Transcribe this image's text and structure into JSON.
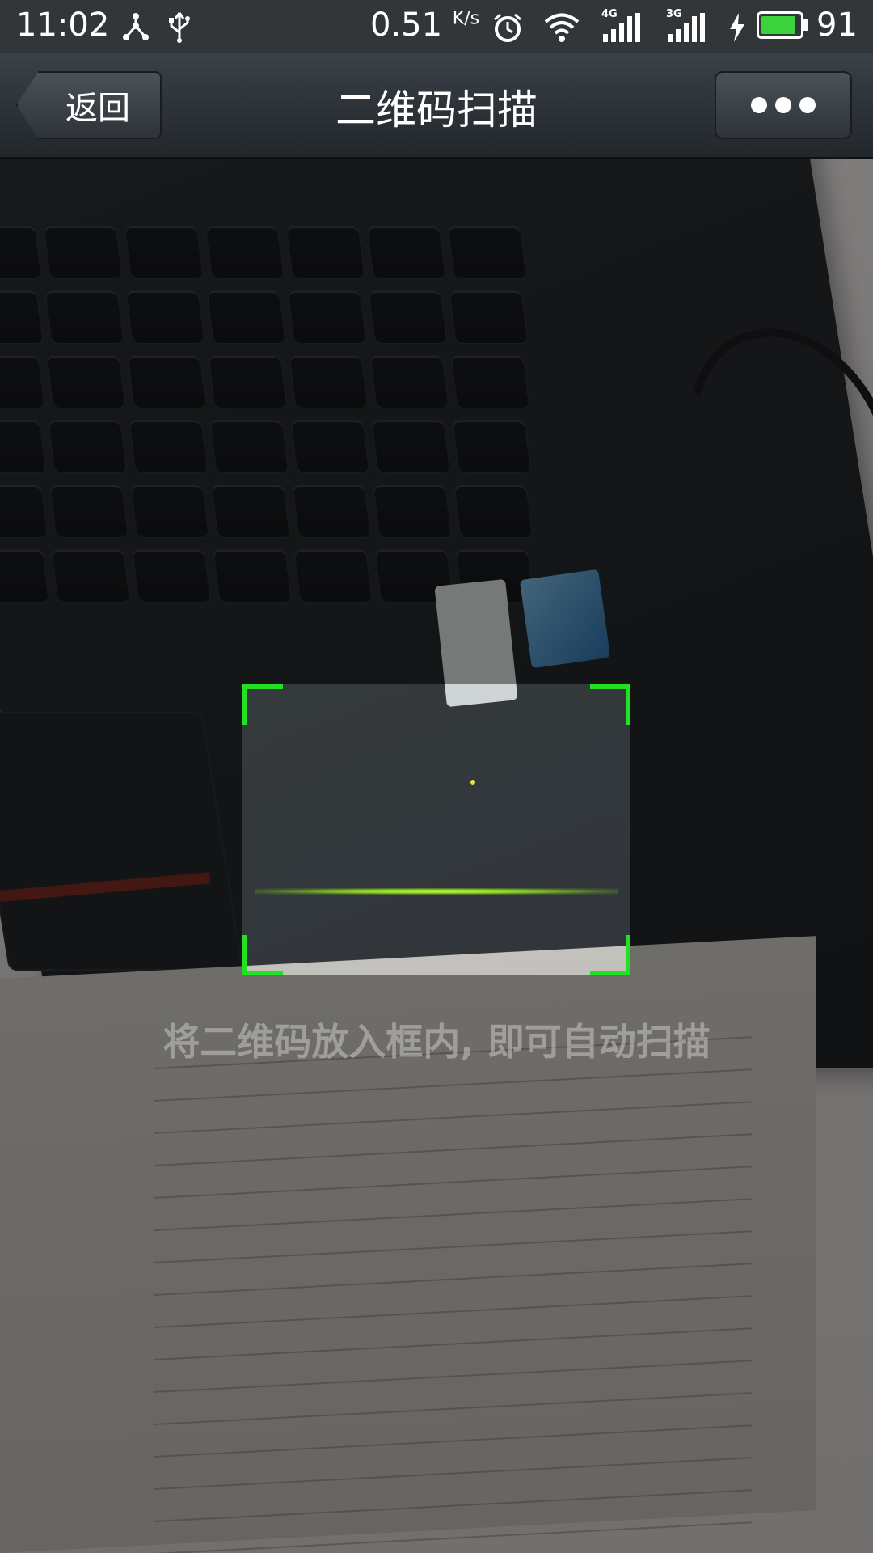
{
  "status_bar": {
    "time": "11:02",
    "speed_value": "0.51",
    "speed_unit": "K/s",
    "network_4g": "4G",
    "network_3g": "3G",
    "battery_level": "91",
    "battery_fraction": 0.91,
    "icons": [
      "share-icon",
      "usb-icon",
      "alarm-icon",
      "wifi-icon",
      "signal-4g-icon",
      "signal-3g-icon",
      "charging-icon",
      "battery-icon"
    ]
  },
  "header": {
    "title": "二维码扫描",
    "back_label": "返回",
    "more_icon": "more-dots-icon"
  },
  "scanner": {
    "hint": "将二维码放入框内, 即可自动扫描",
    "frame_color": "#22e022",
    "scan_line_color": "#8ed324"
  }
}
